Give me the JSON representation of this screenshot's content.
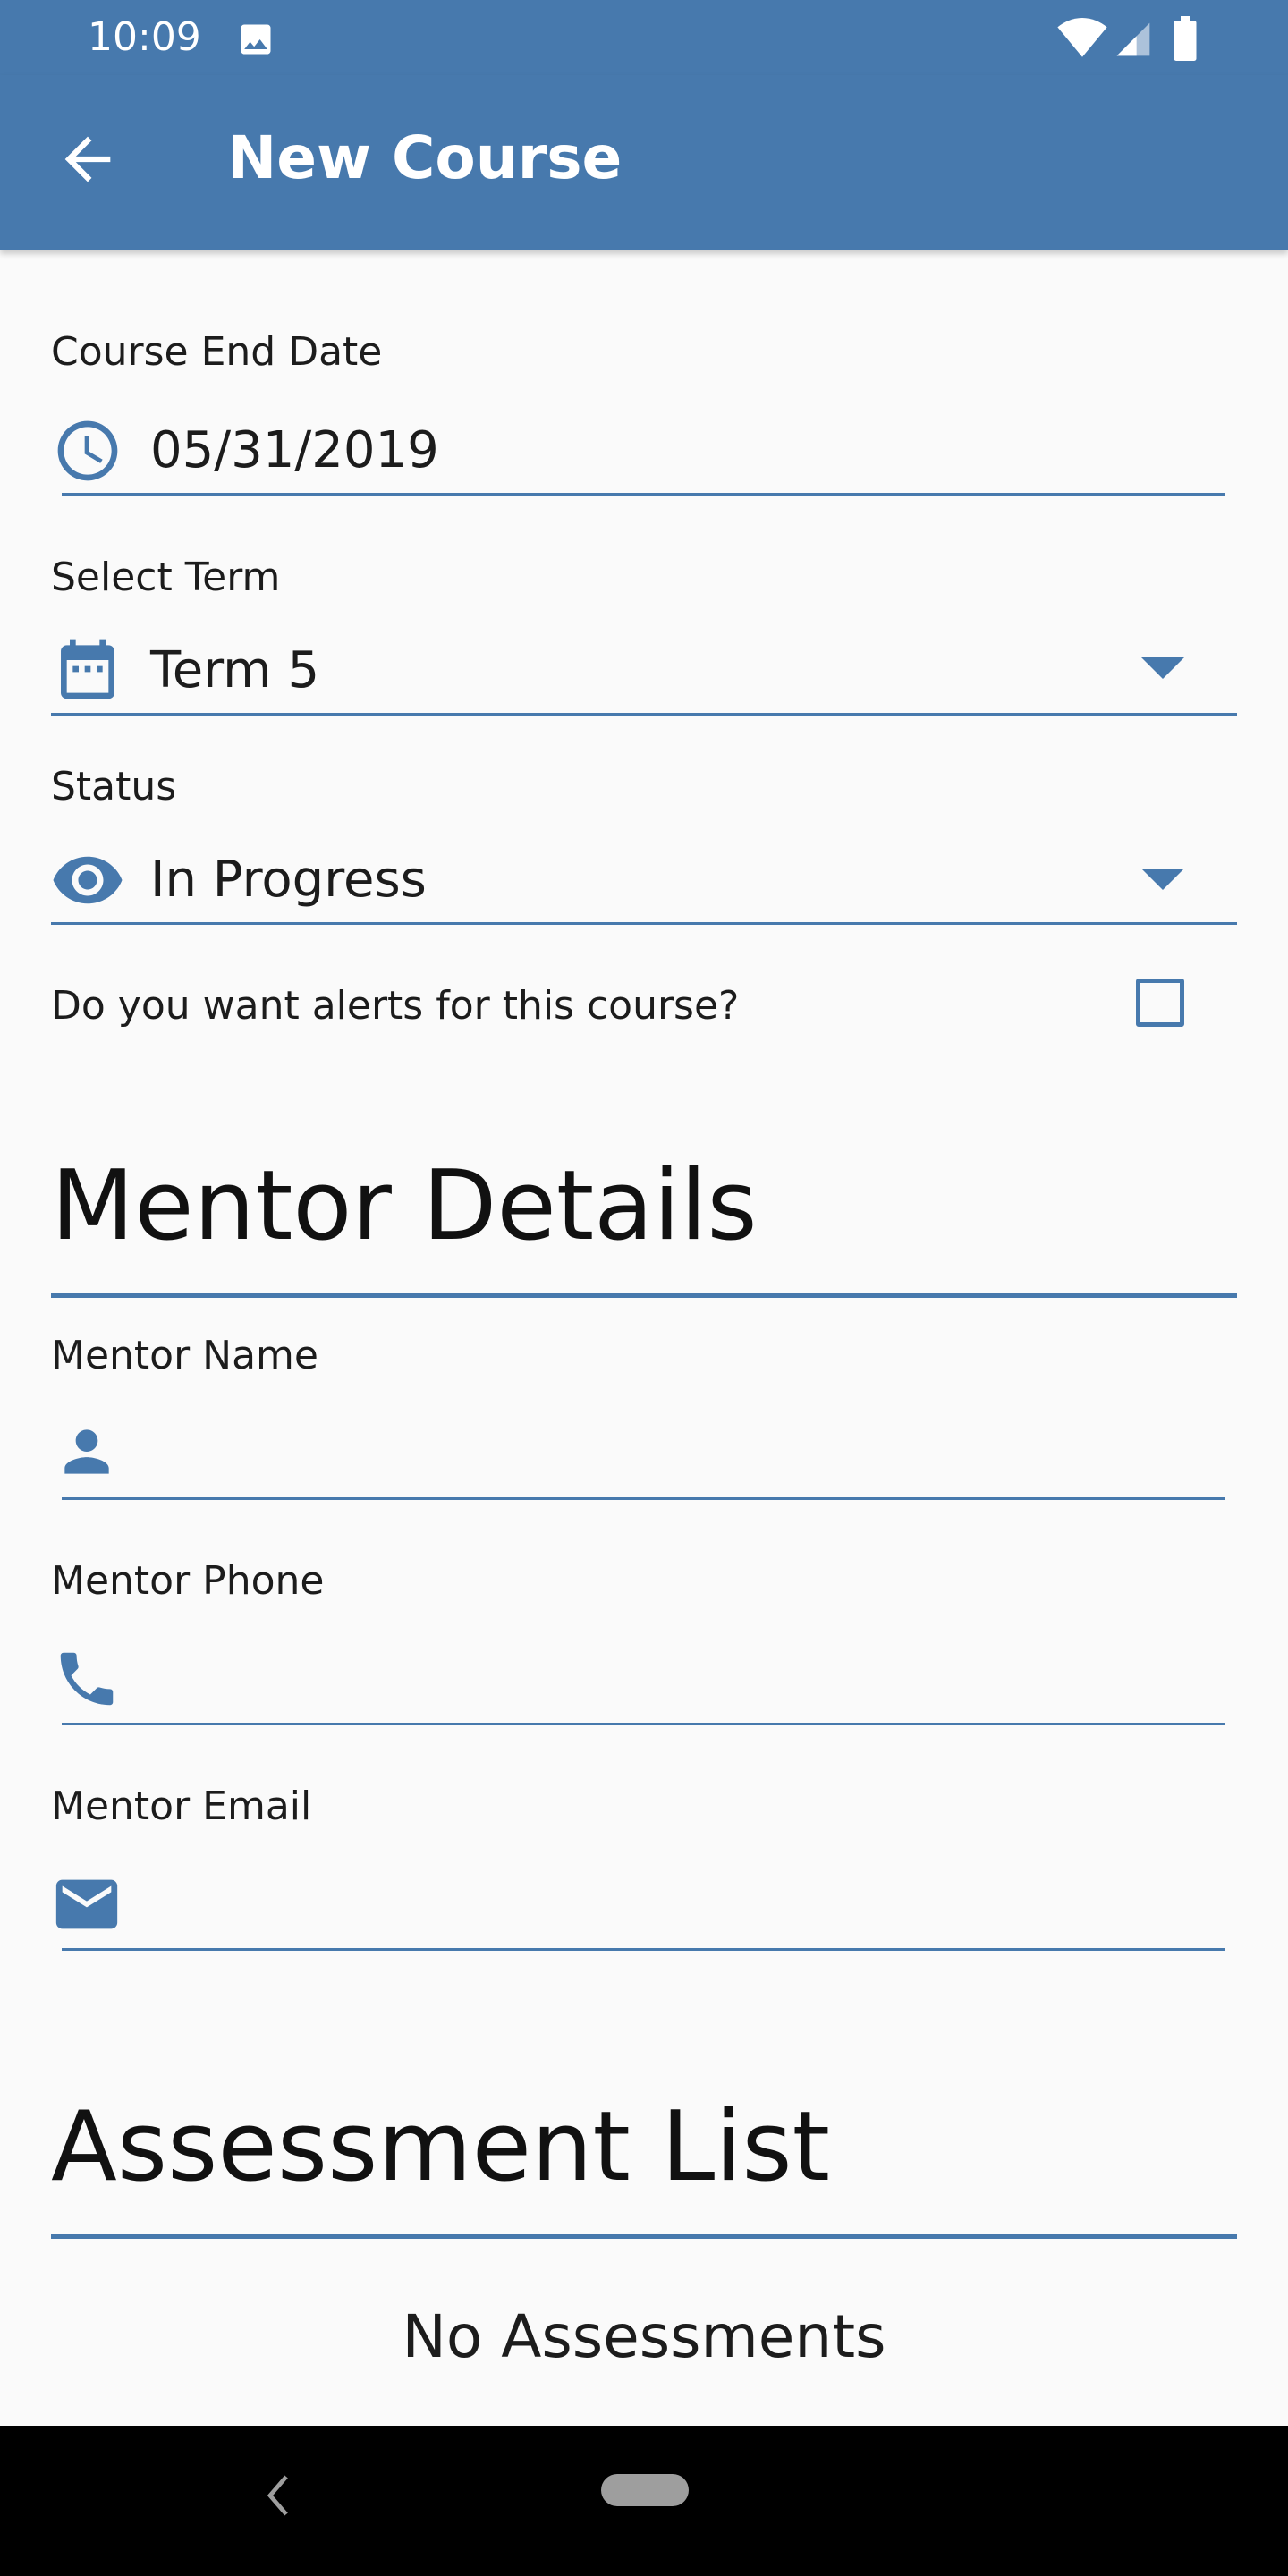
{
  "status_bar": {
    "time": "10:09",
    "icons": [
      "image-icon",
      "wifi-icon",
      "signal-icon",
      "battery-icon"
    ]
  },
  "app_bar": {
    "back_icon": "arrow-left-icon",
    "title": "New Course"
  },
  "form": {
    "end_date": {
      "label": "Course End Date",
      "value": "05/31/2019",
      "icon": "clock-icon"
    },
    "term": {
      "label": "Select Term",
      "value": "Term 5",
      "icon": "calendar-icon"
    },
    "status": {
      "label": "Status",
      "value": "In Progress",
      "icon": "eye-icon"
    },
    "alerts": {
      "label": "Do you want alerts for this course?",
      "checked": false
    }
  },
  "mentor": {
    "heading": "Mentor Details",
    "name_label": "Mentor Name",
    "name_value": "",
    "phone_label": "Mentor Phone",
    "phone_value": "",
    "email_label": "Mentor Email",
    "email_value": ""
  },
  "assessments": {
    "heading": "Assessment List",
    "empty_text": "No Assessments"
  },
  "colors": {
    "primary": "#4779ad",
    "background": "#fafafa",
    "text": "#1c1c1c"
  }
}
